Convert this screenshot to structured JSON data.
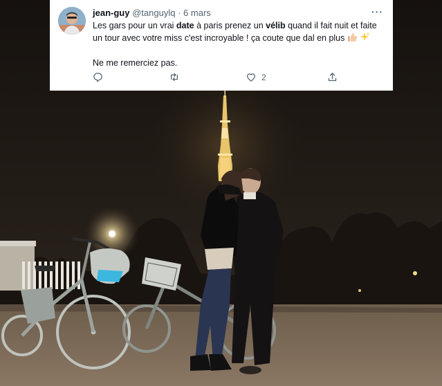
{
  "tweet": {
    "display_name": "jean-guy",
    "handle": "@tanguylq",
    "separator": "·",
    "date": "6 mars",
    "more_icon": "more-horizontal-icon",
    "text_part1": "Les gars pour un vrai ",
    "text_bold1": "date",
    "text_part2": " à paris prenez un ",
    "text_bold2": "vélib",
    "text_part3": " quand il fait nuit et faite un tour avec votre miss c'est incroyable ! ça coute que dal en plus ",
    "emoji_thumbs": "👍🏻",
    "emoji_sparkles": "✨",
    "text_line2": "Ne me remerciez pas.",
    "reply_count": "",
    "retweet_count": "",
    "like_count": "2",
    "icons": [
      "reply-icon",
      "retweet-icon",
      "like-icon",
      "share-icon"
    ]
  },
  "photo": {
    "subject": "couple embracing next to two Vélib bikes, Eiffel Tower lit at night"
  },
  "colors": {
    "text_primary": "#0f1419",
    "text_secondary": "#536471",
    "sky": "#1c1713",
    "tower_light": "#f2d98a"
  }
}
